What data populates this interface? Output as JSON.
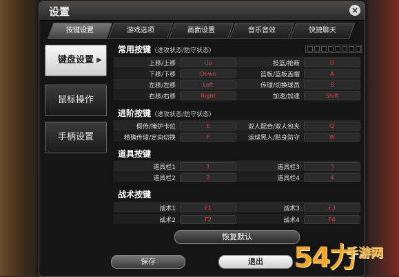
{
  "window": {
    "title": "设置",
    "close_icon": "close-icon"
  },
  "tabs": [
    {
      "label": "按键设置",
      "active": true
    },
    {
      "label": "游戏选项",
      "active": false
    },
    {
      "label": "画面设置",
      "active": false
    },
    {
      "label": "音乐音效",
      "active": false
    },
    {
      "label": "快捷聊天",
      "active": false
    }
  ],
  "sidebar": [
    {
      "label": "键盘设置",
      "active": true
    },
    {
      "label": "鼠标操作",
      "active": false
    },
    {
      "label": "手柄设置",
      "active": false
    }
  ],
  "sections": {
    "common": {
      "title": "常用按键",
      "subtitle": "（进攻状态/防守状态）",
      "rows": [
        {
          "l1": "上移/上移",
          "k1": "Up",
          "l2": "投篮/抢断",
          "k2": "D"
        },
        {
          "l1": "下移/下移",
          "k1": "Down",
          "l2": "篮板/篮板盖帽",
          "k2": "A"
        },
        {
          "l1": "左移/左移",
          "k1": "Left",
          "l2": "传球/切换球员",
          "k2": "S"
        },
        {
          "l1": "右移/右移",
          "k1": "Right",
          "l2": "加速/加速",
          "k2": "Shift"
        }
      ]
    },
    "advanced": {
      "title": "进阶按键",
      "subtitle": "（进攻状态/防守状态）",
      "rows": [
        {
          "l1": "假传/掩护卡位",
          "k1": "E",
          "l2": "双人配合/双人包夹",
          "k2": "Q"
        },
        {
          "l1": "精确传球/定向切换",
          "k1": "F",
          "l2": "运球晃人/贴身防守",
          "k2": "W"
        }
      ]
    },
    "items": {
      "title": "道具按键",
      "rows": [
        {
          "l1": "道具栏1",
          "k1": "1",
          "l2": "道具栏3",
          "k2": "3"
        },
        {
          "l1": "道具栏2",
          "k1": "2",
          "l2": "道具栏4",
          "k2": "4"
        }
      ]
    },
    "tactics": {
      "title": "战术按键",
      "rows": [
        {
          "l1": "战术1",
          "k1": "F1",
          "l2": "战术3",
          "k2": "F3"
        },
        {
          "l1": "战术2",
          "k1": "F2",
          "l2": "战术4",
          "k2": "F4"
        }
      ]
    }
  },
  "buttons": {
    "restore": "恢复默认",
    "save": "保存",
    "exit": "退出"
  },
  "watermark": {
    "num": "54",
    "glyph": "力",
    "text": "手游网"
  },
  "colors": {
    "key_text": "#e04a3a",
    "watermark": "#f5a623"
  }
}
